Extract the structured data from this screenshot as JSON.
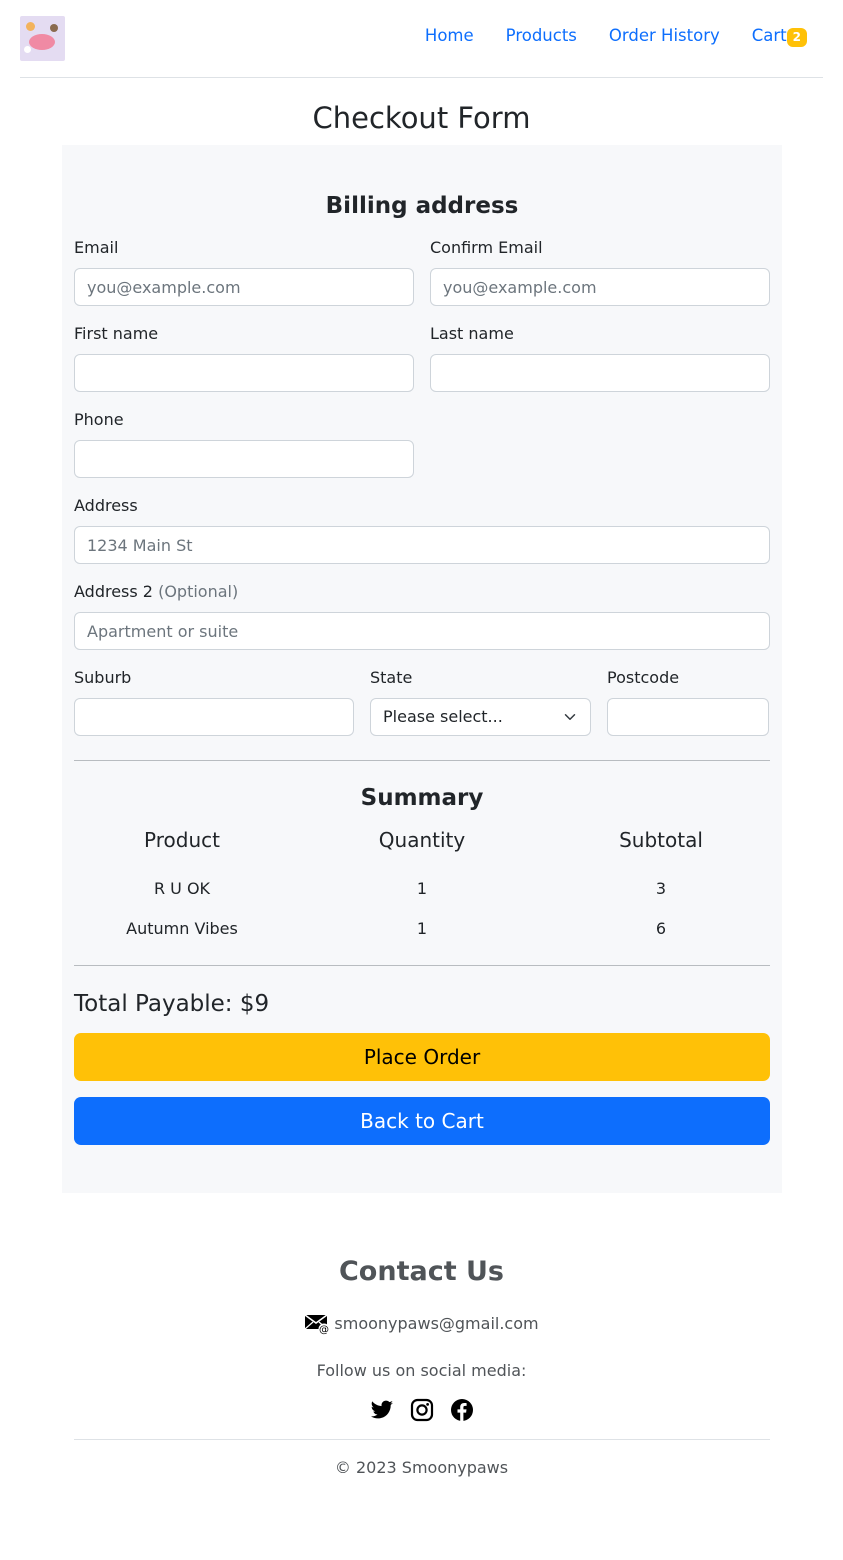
{
  "nav": {
    "logo_alt": "Smoonypaws",
    "links": [
      "Home",
      "Products",
      "Order History"
    ],
    "cart_label": "Cart",
    "cart_count": "2"
  },
  "page": {
    "title": "Checkout Form"
  },
  "billing": {
    "title": "Billing address",
    "email": {
      "label": "Email",
      "placeholder": "you@example.com",
      "value": ""
    },
    "confirm_email": {
      "label": "Confirm Email",
      "placeholder": "you@example.com",
      "value": ""
    },
    "first_name": {
      "label": "First name",
      "value": ""
    },
    "last_name": {
      "label": "Last name",
      "value": ""
    },
    "phone": {
      "label": "Phone",
      "value": ""
    },
    "address": {
      "label": "Address",
      "placeholder": "1234 Main St",
      "value": ""
    },
    "address2": {
      "label": "Address 2",
      "optional": "(Optional)",
      "placeholder": "Apartment or suite",
      "value": ""
    },
    "suburb": {
      "label": "Suburb",
      "value": ""
    },
    "state": {
      "label": "State",
      "selected": "Please select..."
    },
    "postcode": {
      "label": "Postcode",
      "value": ""
    }
  },
  "summary": {
    "title": "Summary",
    "headers": [
      "Product",
      "Quantity",
      "Subtotal"
    ],
    "rows": [
      [
        "R U OK",
        "1",
        "3"
      ],
      [
        "Autumn Vibes",
        "1",
        "6"
      ]
    ],
    "total": "Total Payable: $9",
    "place_order": "Place Order",
    "back_to_cart": "Back to Cart"
  },
  "footer": {
    "contact_title": "Contact Us",
    "email": "smoonypaws@gmail.com",
    "follow": "Follow us on social media:",
    "socials": [
      "twitter-icon",
      "instagram-icon",
      "facebook-icon"
    ],
    "copyright": "© 2023 Smoonypaws"
  },
  "colors": {
    "primary": "#0d6efd",
    "warning": "#ffc107",
    "panel_bg": "#f7f8fa"
  }
}
